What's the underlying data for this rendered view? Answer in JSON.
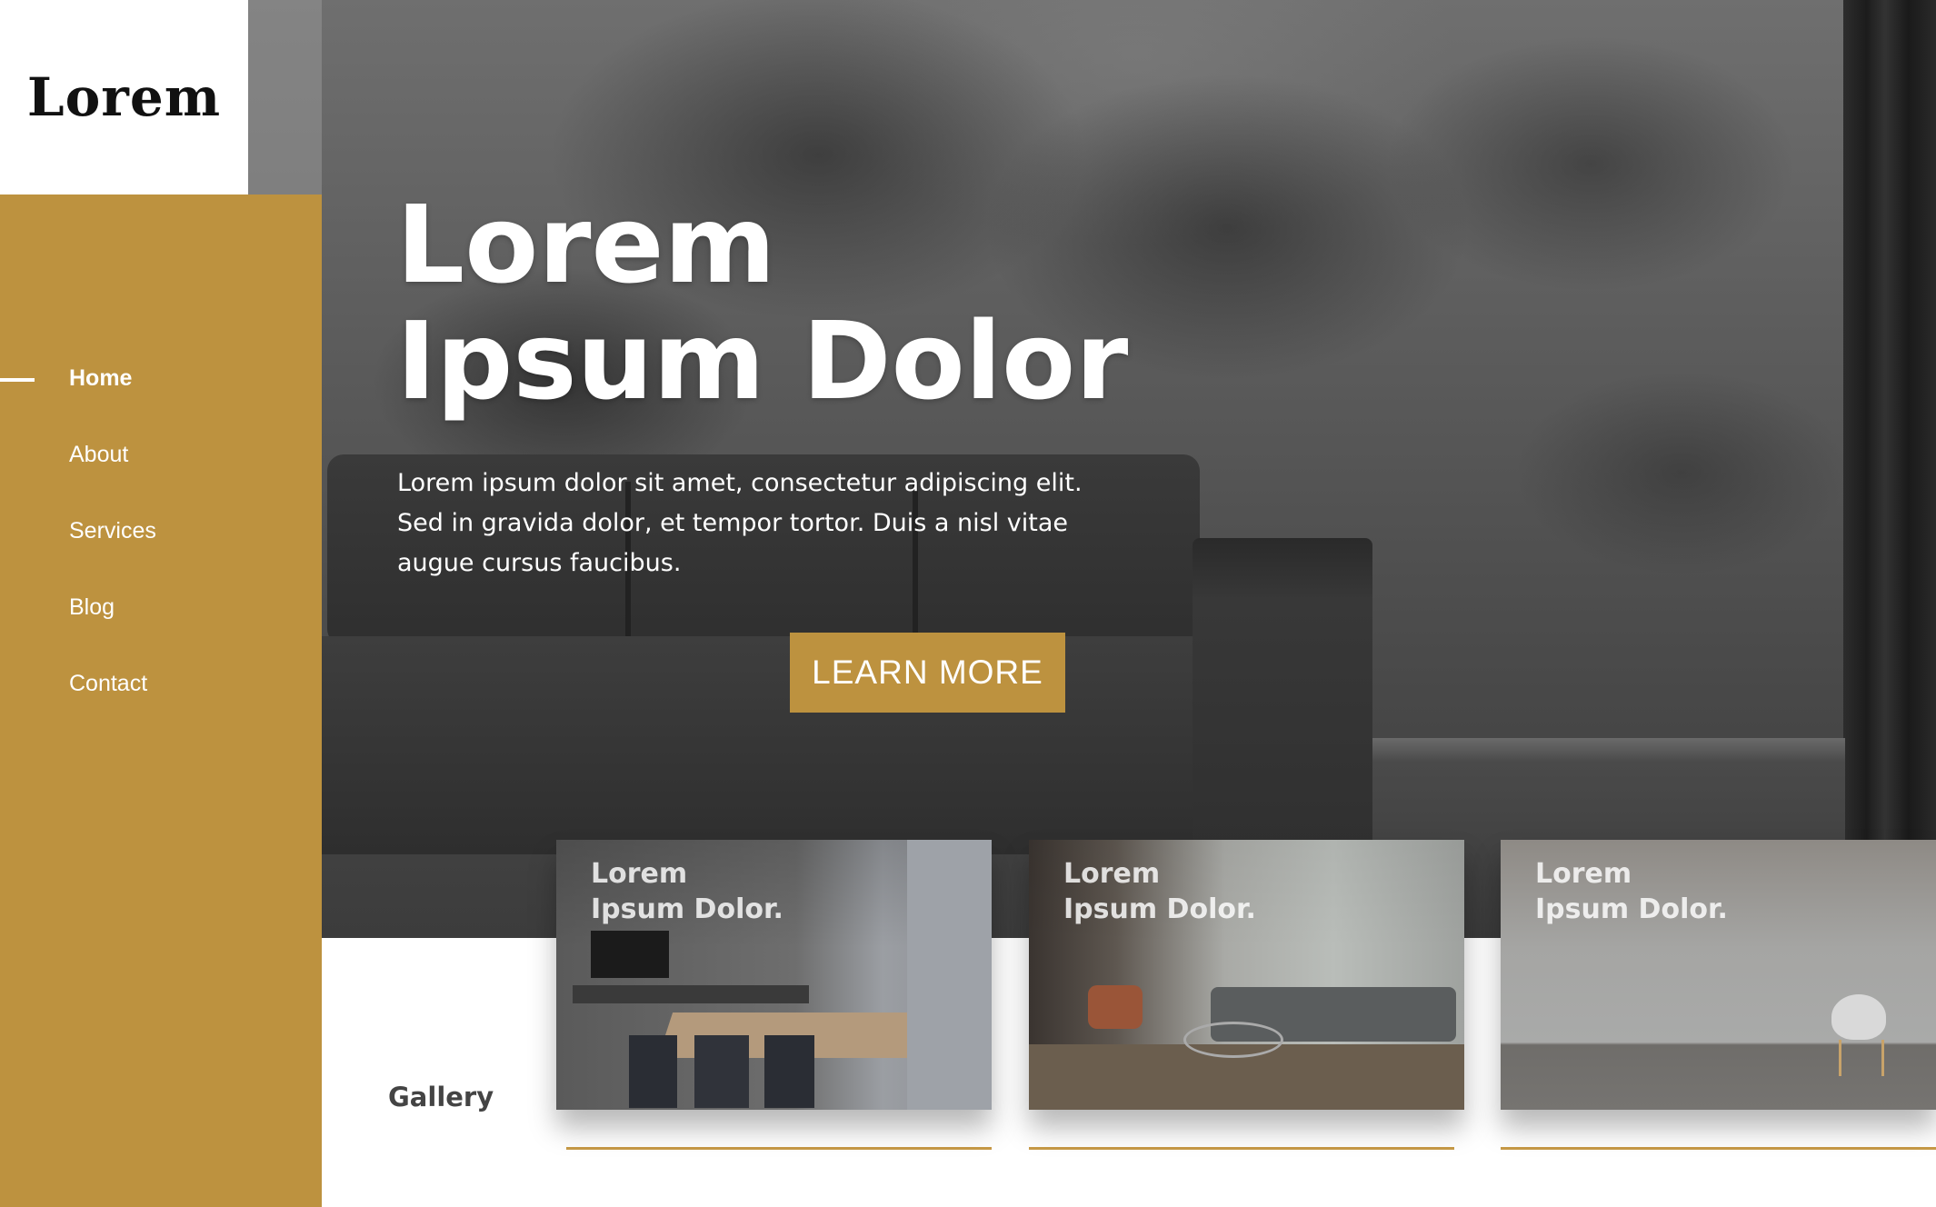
{
  "brand": {
    "logo_text": "Lorem"
  },
  "colors": {
    "accent": "#bd923f",
    "text_light": "#ffffff",
    "text_dark": "#444444"
  },
  "nav": {
    "items": [
      {
        "label": "Home",
        "active": true
      },
      {
        "label": "About",
        "active": false
      },
      {
        "label": "Services",
        "active": false
      },
      {
        "label": "Blog",
        "active": false
      },
      {
        "label": "Contact",
        "active": false
      }
    ]
  },
  "hero": {
    "title_line1": "Lorem",
    "title_line2": "Ipsum Dolor",
    "description": "Lorem ipsum dolor sit amet, consectetur adipiscing elit. Sed in gravida dolor, et tempor tortor. Duis a nisl vitae augue cursus faucibus.",
    "button_label": "LEARN MORE"
  },
  "gallery": {
    "label": "Gallery",
    "cards": [
      {
        "line1": "Lorem",
        "line2": "Ipsum Dolor."
      },
      {
        "line1": "Lorem",
        "line2": "Ipsum Dolor."
      },
      {
        "line1": "Lorem",
        "line2": "Ipsum Dolor."
      }
    ]
  }
}
